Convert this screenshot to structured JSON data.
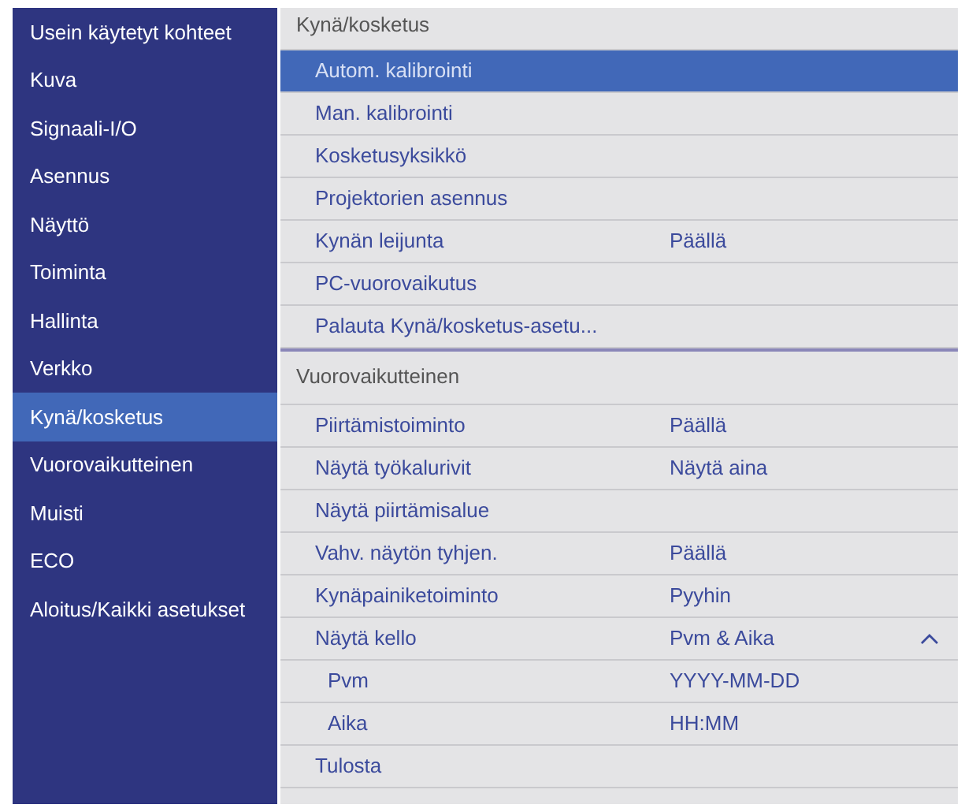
{
  "sidebar": {
    "items": [
      {
        "label": "Usein käytetyt kohteet",
        "selected": false
      },
      {
        "label": "Kuva",
        "selected": false
      },
      {
        "label": "Signaali-I/O",
        "selected": false
      },
      {
        "label": "Asennus",
        "selected": false
      },
      {
        "label": "Näyttö",
        "selected": false
      },
      {
        "label": "Toiminta",
        "selected": false
      },
      {
        "label": "Hallinta",
        "selected": false
      },
      {
        "label": "Verkko",
        "selected": false
      },
      {
        "label": "Kynä/kosketus",
        "selected": true
      },
      {
        "label": "Vuorovaikutteinen",
        "selected": false
      },
      {
        "label": "Muisti",
        "selected": false
      },
      {
        "label": "ECO",
        "selected": false
      },
      {
        "label": "Aloitus/Kaikki asetukset",
        "selected": false
      }
    ]
  },
  "sections": [
    {
      "title": "Kynä/kosketus",
      "items": [
        {
          "label": "Autom. kalibrointi",
          "selected": true
        },
        {
          "label": "Man. kalibrointi",
          "selected": false
        },
        {
          "label": "Kosketusyksikkö",
          "selected": false
        },
        {
          "label": "Projektorien asennus",
          "selected": false
        },
        {
          "label": "Kynän leijunta",
          "value": "Päällä",
          "selected": false
        },
        {
          "label": "PC-vuorovaikutus",
          "selected": false
        },
        {
          "label": "Palauta Kynä/kosketus-asetu...",
          "selected": false
        }
      ]
    },
    {
      "title": "Vuorovaikutteinen",
      "items": [
        {
          "label": "Piirtämistoiminto",
          "value": "Päällä",
          "selected": false
        },
        {
          "label": "Näytä työkalurivit",
          "value": "Näytä aina",
          "selected": false
        },
        {
          "label": "Näytä piirtämisalue",
          "selected": false
        },
        {
          "label": "Vahv. näytön tyhjen.",
          "value": "Päällä",
          "selected": false
        },
        {
          "label": "Kynäpainiketoiminto",
          "value": "Pyyhin",
          "selected": false
        },
        {
          "label": "Näytä kello",
          "value": "Pvm & Aika",
          "selected": false,
          "expanded": true,
          "children": [
            {
              "label": "Pvm",
              "value": "YYYY-MM-DD",
              "selected": false
            },
            {
              "label": "Aika",
              "value": "HH:MM",
              "selected": false
            }
          ]
        },
        {
          "label": "Tulosta",
          "selected": false
        }
      ]
    }
  ]
}
